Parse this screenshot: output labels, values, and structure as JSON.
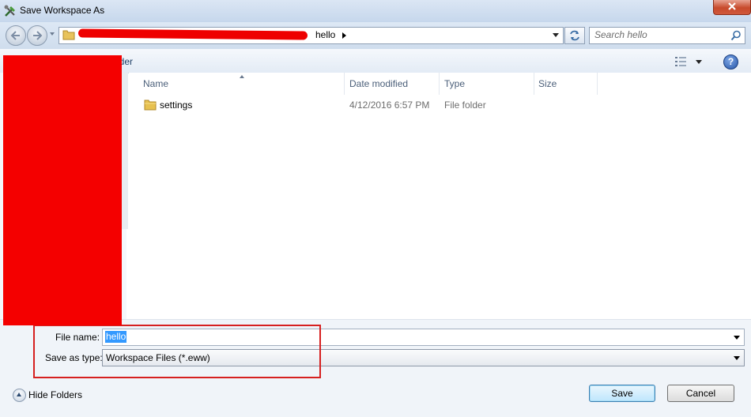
{
  "window": {
    "title": "Save Workspace As"
  },
  "address_bar": {
    "crumb": "hello"
  },
  "search": {
    "placeholder": "Search hello"
  },
  "toolbar": {
    "new_folder_label": "lder"
  },
  "columns": [
    "Name",
    "Date modified",
    "Type",
    "Size"
  ],
  "files": [
    {
      "name": "settings",
      "date_modified": "4/12/2016 6:57 PM",
      "type": "File folder",
      "size": "",
      "icon": "folder-icon"
    }
  ],
  "form": {
    "file_name_label": "File name:",
    "file_name_value": "hello",
    "save_type_label": "Save as type:",
    "save_type_value": "Workspace Files (*.eww)"
  },
  "footer": {
    "hide_folders_label": "Hide Folders",
    "save_label": "Save",
    "cancel_label": "Cancel"
  },
  "colors": {
    "redaction": "#f40000",
    "highlight_box": "#d62020",
    "selection": "#3399ff"
  }
}
